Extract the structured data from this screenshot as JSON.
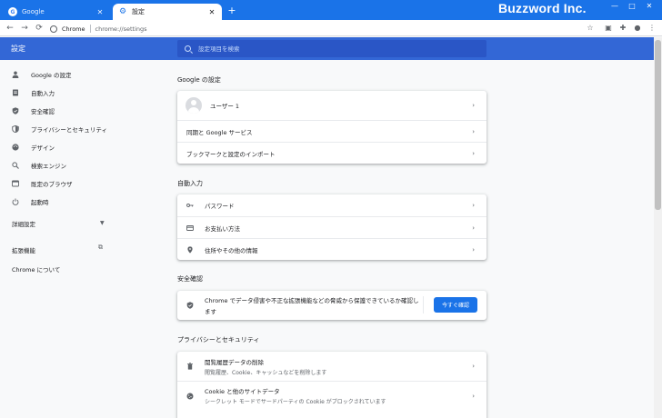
{
  "browser": {
    "tabs": [
      {
        "title": "Google",
        "favicon": "G",
        "close": "✕"
      },
      {
        "title": "設定",
        "favicon": "⚙",
        "close": "✕"
      }
    ],
    "new_tab": "+",
    "watermark": "Buzzword Inc.",
    "window_controls": [
      "—",
      "□",
      "✕"
    ],
    "nav": {
      "back": "←",
      "forward": "→",
      "reload": "⟳"
    },
    "omnibox": {
      "site_label": "Chrome",
      "url": "chrome://settings"
    }
  },
  "header": {
    "title": "設定",
    "search_placeholder": "設定項目を検索"
  },
  "sidebar": {
    "items": [
      {
        "label": "Google の設定",
        "icon": "person-icon"
      },
      {
        "label": "自動入力",
        "icon": "clipboard-icon"
      },
      {
        "label": "安全確認",
        "icon": "shield-icon"
      },
      {
        "label": "プライバシーとセキュリティ",
        "icon": "shield-lock-icon"
      },
      {
        "label": "デザイン",
        "icon": "palette-icon"
      },
      {
        "label": "検索エンジン",
        "icon": "search-icon"
      },
      {
        "label": "既定のブラウザ",
        "icon": "browser-icon"
      },
      {
        "label": "起動時",
        "icon": "power-icon"
      }
    ],
    "advanced": "詳細設定",
    "extensions": "拡張機能",
    "about": "Chrome について"
  },
  "main": {
    "google": {
      "title": "Google の設定",
      "user": "ユーザー 1",
      "sync": "同期と Google サービス",
      "import": "ブックマークと設定のインポート"
    },
    "autofill": {
      "title": "自動入力",
      "passwords": "パスワード",
      "payments": "お支払い方法",
      "addresses": "住所やその他の情報"
    },
    "safety": {
      "title": "安全確認",
      "text_line1": "Chrome でデータ侵害や不正な拡張機能などの脅威から保護できているか確認し",
      "text_line2": "ます",
      "button": "今すぐ確認"
    },
    "privacy": {
      "title": "プライバシーとセキュリティ",
      "clear_title": "閲覧履歴データの削除",
      "clear_sub": "閲覧履歴、Cookie、キャッシュなどを削除します",
      "cookies_title": "Cookie と他のサイトデータ",
      "cookies_sub": "シークレット モードでサードパーティの Cookie がブロックされています"
    }
  },
  "colors": {
    "tabstrip": "#1a73e8",
    "header": "#3367d6",
    "accent": "#1a73e8"
  }
}
